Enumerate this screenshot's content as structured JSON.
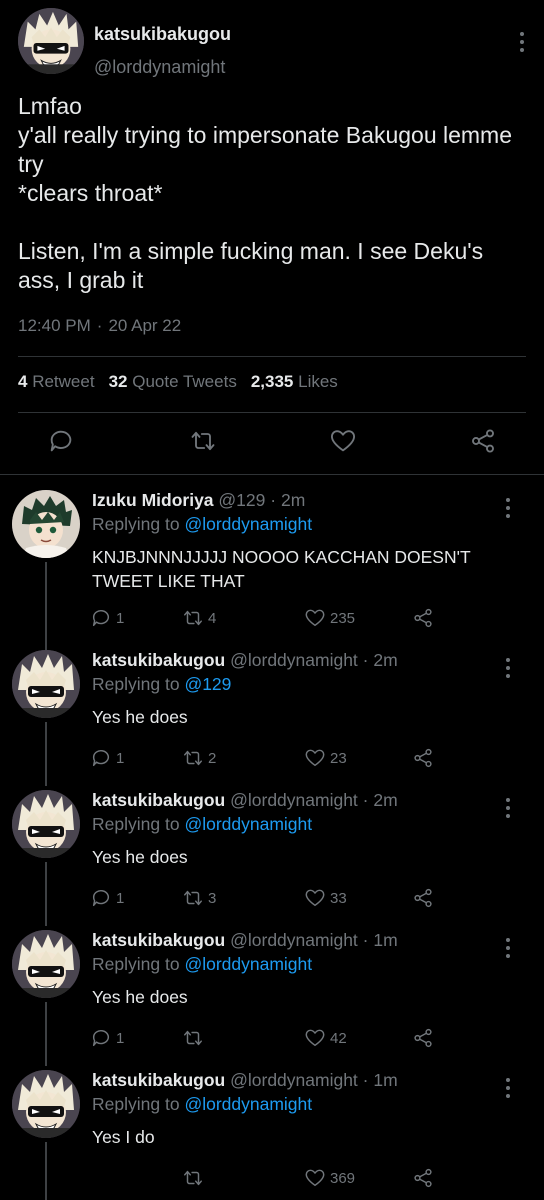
{
  "main": {
    "name": "katsukibakugou",
    "handle": "@lorddynamight",
    "text": "Lmfao\ny'all really trying to impersonate Bakugou lemme try\n*clears throat*\n\nListen, I'm a simple fucking man. I see Deku's ass, I grab it",
    "time": "12:40 PM",
    "date": "20 Apr 22",
    "stats": {
      "retweets": "4",
      "retweets_label": "Retweet",
      "quotes": "32",
      "quotes_label": "Quote Tweets",
      "likes": "2,335",
      "likes_label": "Likes"
    },
    "icons": [
      "reply-icon",
      "retweet-icon",
      "like-icon",
      "share-icon"
    ]
  },
  "replies": [
    {
      "name": "Izuku Midoriya",
      "handle": "@129",
      "time": "2m",
      "replying_label": "Replying to",
      "replying_to": "@lorddynamight",
      "text": "KNJBJNNNJJJJJ NOOOO KACCHAN DOESN'T TWEET LIKE THAT",
      "replies": "1",
      "retweets": "4",
      "likes": "235"
    },
    {
      "name": "katsukibakugou",
      "handle": "@lorddynamight",
      "time": "2m",
      "replying_label": "Replying to",
      "replying_to": "@129",
      "text": "Yes he does",
      "replies": "1",
      "retweets": "2",
      "likes": "23"
    },
    {
      "name": "katsukibakugou",
      "handle": "@lorddynamight",
      "time": "2m",
      "replying_label": "Replying to",
      "replying_to": "@lorddynamight",
      "text": "Yes he does",
      "replies": "1",
      "retweets": "3",
      "likes": "33"
    },
    {
      "name": "katsukibakugou",
      "handle": "@lorddynamight",
      "time": "1m",
      "replying_label": "Replying to",
      "replying_to": "@lorddynamight",
      "text": "Yes he does",
      "replies": "1",
      "retweets": "",
      "likes": "42"
    },
    {
      "name": "katsukibakugou",
      "handle": "@lorddynamight",
      "time": "1m",
      "replying_label": "Replying to",
      "replying_to": "@lorddynamight",
      "text": "Yes I do",
      "replies": "",
      "retweets": "",
      "likes": "369"
    }
  ],
  "separator": "·",
  "colors": {
    "background": "#000000",
    "text": "#e7e9ea",
    "muted": "#71767b",
    "link": "#1d9bf0"
  }
}
